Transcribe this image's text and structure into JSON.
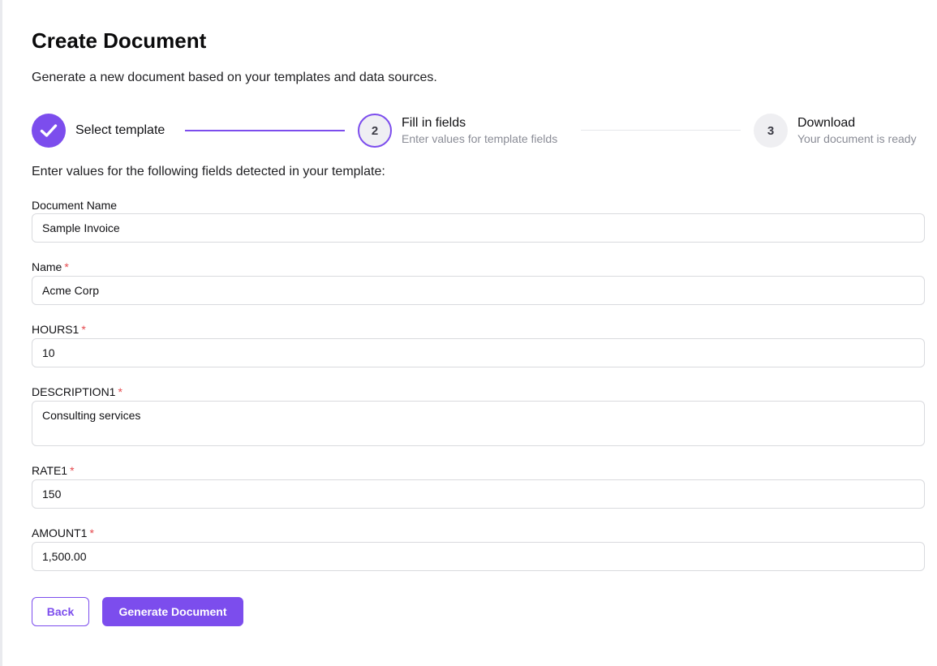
{
  "page": {
    "title": "Create Document",
    "subtitle": "Generate a new document based on your templates and data sources."
  },
  "stepper": {
    "steps": [
      {
        "label": "Select template",
        "description": "",
        "number": "1",
        "state": "completed"
      },
      {
        "label": "Fill in fields",
        "description": "Enter values for template fields",
        "number": "2",
        "state": "active"
      },
      {
        "label": "Download",
        "description": "Your document is ready",
        "number": "3",
        "state": "upcoming"
      }
    ]
  },
  "form": {
    "intro": "Enter values for the following fields detected in your template:",
    "fields": [
      {
        "label": "Document Name",
        "value": "Sample Invoice",
        "required": false
      },
      {
        "label": "Name",
        "value": "Acme Corp",
        "required": true
      },
      {
        "label": "HOURS1",
        "value": "10",
        "required": true
      },
      {
        "label": "DESCRIPTION1",
        "value": "Consulting services",
        "required": true
      },
      {
        "label": "RATE1",
        "value": "150",
        "required": true
      },
      {
        "label": "AMOUNT1",
        "value": "1,500.00",
        "required": true
      }
    ],
    "required_marker": "*"
  },
  "actions": {
    "back_label": "Back",
    "generate_label": "Generate Document"
  },
  "colors": {
    "accent": "#7c4ded",
    "required": "#e5484d",
    "muted_text": "#8a8c96",
    "border": "#d9dade"
  },
  "icons": {
    "completed_step": "checkmark-icon"
  }
}
